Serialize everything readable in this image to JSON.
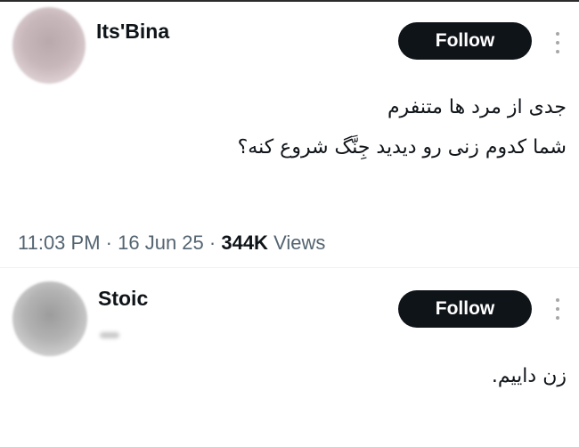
{
  "tweet": {
    "author": {
      "name": "Its'Bina",
      "avatar": "blurred-avatar"
    },
    "follow_label": "Follow",
    "more_icon": "more-vertical-icon",
    "text_lines": [
      "جدی از مرد ها متنفرم",
      "شما کدوم زنی رو دیدید جِنَّگ شروع کنه؟"
    ],
    "time": "11:03 PM",
    "date": "16 Jun 25",
    "separator": "·",
    "views_count": "344K",
    "views_label": "Views"
  },
  "reply": {
    "author": {
      "name": "Stoic",
      "avatar": "blurred-avatar"
    },
    "follow_label": "Follow",
    "more_icon": "more-vertical-icon",
    "text": "زن داییم."
  },
  "colors": {
    "text_primary": "#0f1419",
    "text_secondary": "#536471",
    "button_bg": "#0f1419",
    "button_text": "#ffffff",
    "icon_gray": "#a7a7a7"
  }
}
